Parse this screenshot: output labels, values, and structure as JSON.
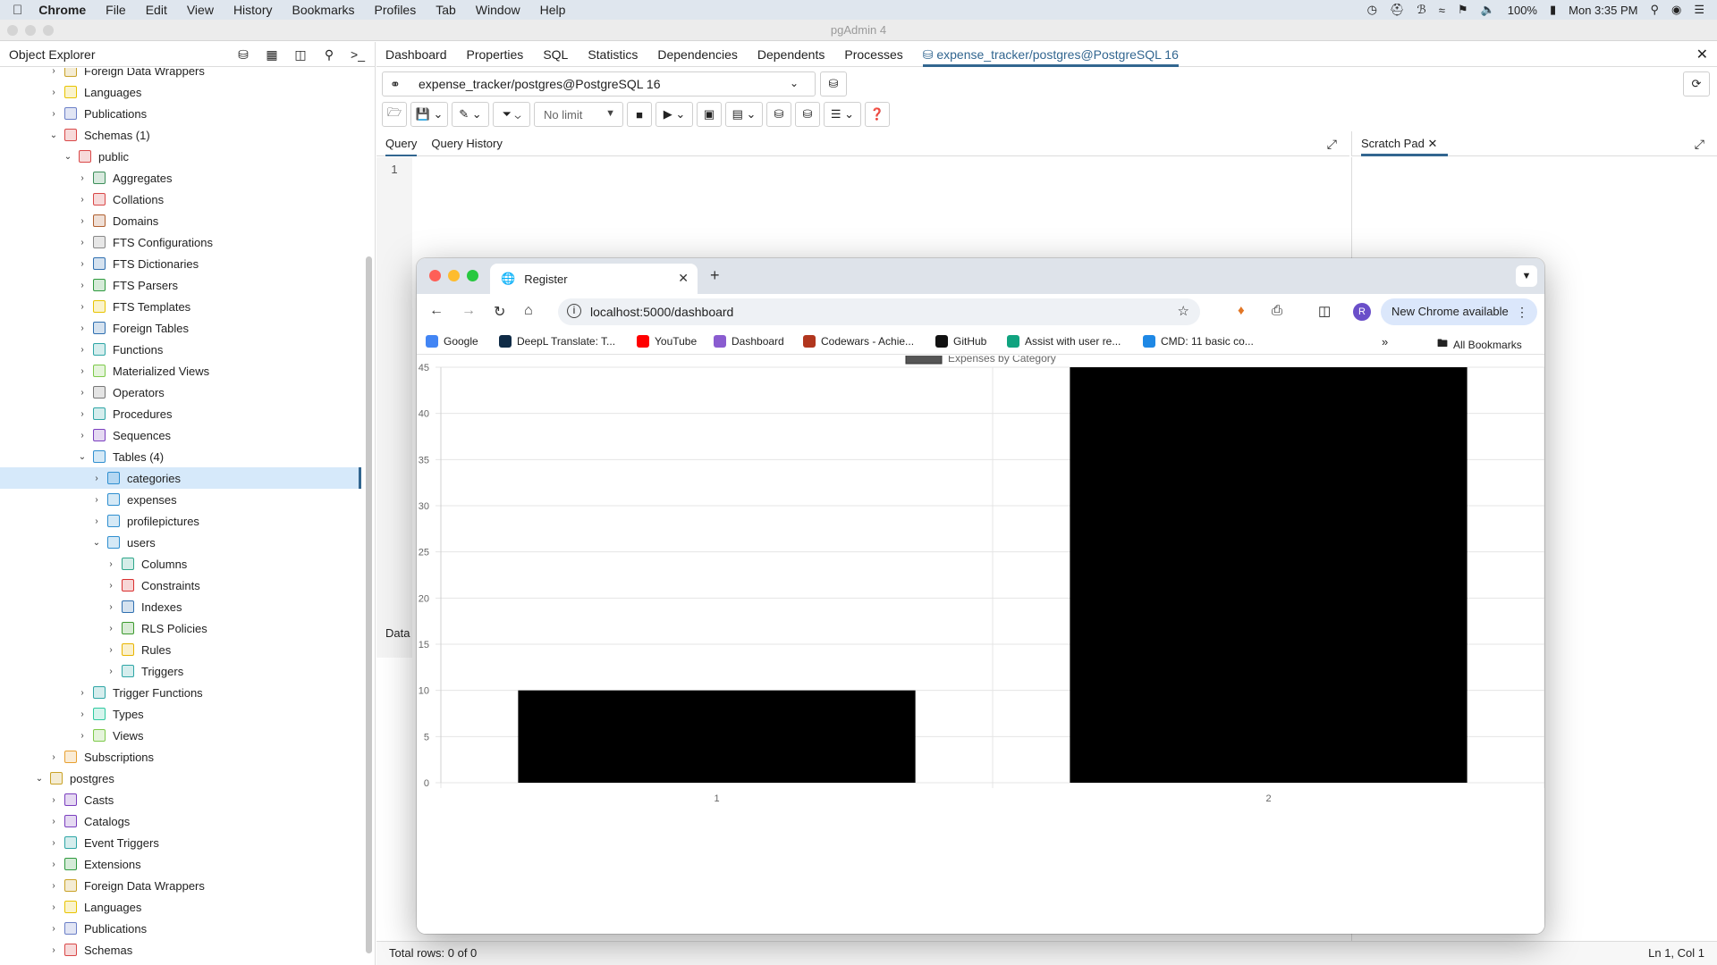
{
  "menubar": {
    "app": "Chrome",
    "items": [
      "File",
      "Edit",
      "View",
      "History",
      "Bookmarks",
      "Profiles",
      "Tab",
      "Window",
      "Help"
    ],
    "battery": "100%",
    "clock": "Mon 3:35 PM"
  },
  "pgadmin": {
    "window_title": "pgAdmin 4",
    "object_explorer_title": "Object Explorer",
    "tree": [
      {
        "label": "Foreign Data Wrappers",
        "level": 2,
        "chev": "right",
        "icon": "fdw-icon",
        "color": "#c9a227"
      },
      {
        "label": "Languages",
        "level": 2,
        "chev": "right",
        "icon": "language-icon",
        "color": "#e8c400"
      },
      {
        "label": "Publications",
        "level": 2,
        "chev": "right",
        "icon": "publication-icon",
        "color": "#6b7fc7"
      },
      {
        "label": "Schemas (1)",
        "level": 2,
        "chev": "down",
        "icon": "schemas-icon",
        "color": "#d94848"
      },
      {
        "label": "public",
        "level": 3,
        "chev": "down",
        "icon": "schema-icon",
        "color": "#d94848"
      },
      {
        "label": "Aggregates",
        "level": 4,
        "chev": "right",
        "icon": "aggregate-icon",
        "color": "#3c8f5a"
      },
      {
        "label": "Collations",
        "level": 4,
        "chev": "right",
        "icon": "collation-icon",
        "color": "#d94848"
      },
      {
        "label": "Domains",
        "level": 4,
        "chev": "right",
        "icon": "domain-icon",
        "color": "#b06030"
      },
      {
        "label": "FTS Configurations",
        "level": 4,
        "chev": "right",
        "icon": "fts-config-icon",
        "color": "#888888"
      },
      {
        "label": "FTS Dictionaries",
        "level": 4,
        "chev": "right",
        "icon": "fts-dictionary-icon",
        "color": "#2f6fb0"
      },
      {
        "label": "FTS Parsers",
        "level": 4,
        "chev": "right",
        "icon": "fts-parser-icon",
        "color": "#2e9a3e"
      },
      {
        "label": "FTS Templates",
        "level": 4,
        "chev": "right",
        "icon": "fts-template-icon",
        "color": "#e8c400"
      },
      {
        "label": "Foreign Tables",
        "level": 4,
        "chev": "right",
        "icon": "foreign-table-icon",
        "color": "#2f6fb0"
      },
      {
        "label": "Functions",
        "level": 4,
        "chev": "right",
        "icon": "function-icon",
        "color": "#2ea6a6"
      },
      {
        "label": "Materialized Views",
        "level": 4,
        "chev": "right",
        "icon": "mview-icon",
        "color": "#7dc94a"
      },
      {
        "label": "Operators",
        "level": 4,
        "chev": "right",
        "icon": "operator-icon",
        "color": "#777777"
      },
      {
        "label": "Procedures",
        "level": 4,
        "chev": "right",
        "icon": "procedure-icon",
        "color": "#2ea6a6"
      },
      {
        "label": "Sequences",
        "level": 4,
        "chev": "right",
        "icon": "sequence-icon",
        "color": "#7b3fbf"
      },
      {
        "label": "Tables (4)",
        "level": 4,
        "chev": "down",
        "icon": "tables-icon",
        "color": "#2f8fd0"
      },
      {
        "label": "categories",
        "level": 5,
        "chev": "right",
        "icon": "table-icon",
        "color": "#2f8fd0",
        "selected": true
      },
      {
        "label": "expenses",
        "level": 5,
        "chev": "right",
        "icon": "table-icon",
        "color": "#2f8fd0"
      },
      {
        "label": "profilepictures",
        "level": 5,
        "chev": "right",
        "icon": "table-icon",
        "color": "#2f8fd0"
      },
      {
        "label": "users",
        "level": 5,
        "chev": "down",
        "icon": "table-icon",
        "color": "#2f8fd0"
      },
      {
        "label": "Columns",
        "level": 6,
        "chev": "right",
        "icon": "columns-icon",
        "color": "#2ea68a"
      },
      {
        "label": "Constraints",
        "level": 6,
        "chev": "right",
        "icon": "constraints-icon",
        "color": "#d93030"
      },
      {
        "label": "Indexes",
        "level": 6,
        "chev": "right",
        "icon": "indexes-icon",
        "color": "#2f6fb0"
      },
      {
        "label": "RLS Policies",
        "level": 6,
        "chev": "right",
        "icon": "rls-policy-icon",
        "color": "#3c9a2e"
      },
      {
        "label": "Rules",
        "level": 6,
        "chev": "right",
        "icon": "rules-icon",
        "color": "#e8b400"
      },
      {
        "label": "Triggers",
        "level": 6,
        "chev": "right",
        "icon": "triggers-icon",
        "color": "#2ea6a6"
      },
      {
        "label": "Trigger Functions",
        "level": 4,
        "chev": "right",
        "icon": "trigger-function-icon",
        "color": "#2ea6a6"
      },
      {
        "label": "Types",
        "level": 4,
        "chev": "right",
        "icon": "types-icon",
        "color": "#2ec9a0"
      },
      {
        "label": "Views",
        "level": 4,
        "chev": "right",
        "icon": "views-icon",
        "color": "#7dc94a"
      },
      {
        "label": "Subscriptions",
        "level": 2,
        "chev": "right",
        "icon": "subscription-icon",
        "color": "#e8a030"
      },
      {
        "label": "postgres",
        "level": 1,
        "chev": "down",
        "icon": "database-icon",
        "color": "#c9a227"
      },
      {
        "label": "Casts",
        "level": 2,
        "chev": "right",
        "icon": "cast-icon",
        "color": "#7b3fbf"
      },
      {
        "label": "Catalogs",
        "level": 2,
        "chev": "right",
        "icon": "catalog-icon",
        "color": "#7b3fbf"
      },
      {
        "label": "Event Triggers",
        "level": 2,
        "chev": "right",
        "icon": "event-trigger-icon",
        "color": "#2ea6a6"
      },
      {
        "label": "Extensions",
        "level": 2,
        "chev": "right",
        "icon": "extension-icon",
        "color": "#2e9a3e"
      },
      {
        "label": "Foreign Data Wrappers",
        "level": 2,
        "chev": "right",
        "icon": "fdw-icon",
        "color": "#c9a227"
      },
      {
        "label": "Languages",
        "level": 2,
        "chev": "right",
        "icon": "language-icon",
        "color": "#e8c400"
      },
      {
        "label": "Publications",
        "level": 2,
        "chev": "right",
        "icon": "publication-icon",
        "color": "#6b7fc7"
      },
      {
        "label": "Schemas",
        "level": 2,
        "chev": "right",
        "icon": "schemas-icon",
        "color": "#d94848"
      }
    ],
    "main_tabs": [
      "Dashboard",
      "Properties",
      "SQL",
      "Statistics",
      "Dependencies",
      "Dependents",
      "Processes"
    ],
    "active_tab": "expense_tracker/postgres@PostgreSQL 16",
    "connection": "expense_tracker/postgres@PostgreSQL 16",
    "limit": "No limit",
    "query_tabs": [
      "Query",
      "Query History"
    ],
    "scratch_pad": "Scratch Pad",
    "line_number": "1",
    "data_output_label": "Data",
    "status_rows": "Total rows: 0 of 0",
    "status_position": "Ln 1, Col 1"
  },
  "chrome": {
    "tab_title": "Register",
    "url": "localhost:5000/dashboard",
    "update_button": "New Chrome available",
    "avatar_letter": "R",
    "bookmarks": [
      {
        "label": "Google",
        "icon": "google-icon",
        "color": "#4285f4"
      },
      {
        "label": "DeepL Translate: T...",
        "icon": "deepl-icon",
        "color": "#0f2b46"
      },
      {
        "label": "YouTube",
        "icon": "youtube-icon",
        "color": "#ff0000"
      },
      {
        "label": "Dashboard",
        "icon": "dashboard-icon",
        "color": "#8a5cd0"
      },
      {
        "label": "Codewars - Achie...",
        "icon": "codewars-icon",
        "color": "#b1361e"
      },
      {
        "label": "GitHub",
        "icon": "github-icon",
        "color": "#111111"
      },
      {
        "label": "Assist with user re...",
        "icon": "chatgpt-icon",
        "color": "#10a37f"
      },
      {
        "label": "CMD: 11 basic co...",
        "icon": "cmd-icon",
        "color": "#1e88e5"
      }
    ],
    "all_bookmarks": "All Bookmarks"
  },
  "chart_data": {
    "type": "bar",
    "categories": [
      "1",
      "2"
    ],
    "series": [
      {
        "name": "Expenses by Category",
        "values": [
          10,
          45
        ],
        "color": "#000000"
      }
    ],
    "ylim": [
      0,
      45
    ],
    "yticks": [
      0,
      5,
      10,
      15,
      20,
      25,
      30,
      35,
      40,
      45
    ],
    "grid": true,
    "legend": "top-center"
  }
}
